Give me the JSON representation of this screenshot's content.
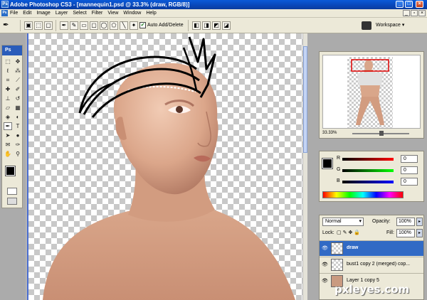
{
  "titlebar": {
    "title": "Adobe Photoshop CS3 - [mannequin1.psd @ 33.3% (draw, RGB/8)]",
    "app_icon": "Ps",
    "min_glyph": "_",
    "max_glyph": "□",
    "close_glyph": "×"
  },
  "menubar": {
    "app_icon": "Ps",
    "items": [
      "File",
      "Edit",
      "Image",
      "Layer",
      "Select",
      "Filter",
      "View",
      "Window",
      "Help"
    ]
  },
  "optionsbar": {
    "tool_icon": "pen-icon",
    "tool_glyph": "✒",
    "auto_add_delete_label": "Auto Add/Delete",
    "auto_add_delete_checked": true,
    "workspace_label": "Workspace ▾"
  },
  "tools": {
    "header": "Ps",
    "foreground_color": "#000000",
    "background_color": "#ffffff"
  },
  "navigator": {
    "zoom": "33.33%"
  },
  "color_panel": {
    "r_label": "R",
    "g_label": "G",
    "b_label": "B",
    "r_value": "0",
    "g_value": "0",
    "b_value": "0"
  },
  "layers": {
    "blend_mode": "Normal",
    "opacity_label": "Opacity:",
    "opacity_value": "100%",
    "lock_label": "Lock:",
    "fill_label": "Fill:",
    "fill_value": "100%",
    "items": [
      {
        "name": "draw",
        "visible": true,
        "active": true
      },
      {
        "name": "bust1 copy 2 (merged) cop...",
        "visible": true,
        "active": false
      },
      {
        "name": "Layer 1 copy 5",
        "visible": true,
        "active": false
      }
    ]
  },
  "watermark": "pxleyes.com",
  "colors": {
    "titlebar": "#0a5ad8",
    "selection": "#316ac5",
    "panel_bg": "#ece9d8",
    "workspace_bg": "#ababab"
  }
}
